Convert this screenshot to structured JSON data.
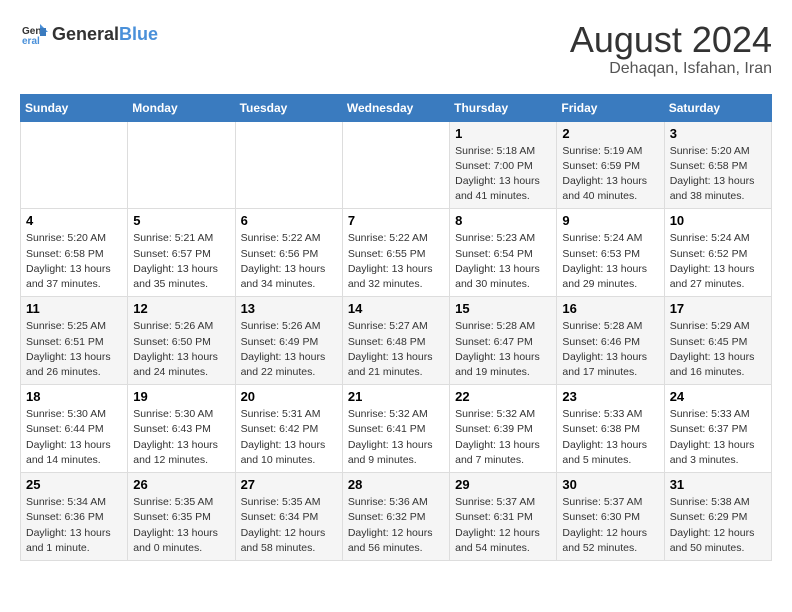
{
  "header": {
    "logo": {
      "general": "General",
      "blue": "Blue"
    },
    "title": "August 2024",
    "subtitle": "Dehaqan, Isfahan, Iran"
  },
  "weekdays": [
    "Sunday",
    "Monday",
    "Tuesday",
    "Wednesday",
    "Thursday",
    "Friday",
    "Saturday"
  ],
  "weeks": [
    [
      {
        "day": "",
        "content": ""
      },
      {
        "day": "",
        "content": ""
      },
      {
        "day": "",
        "content": ""
      },
      {
        "day": "",
        "content": ""
      },
      {
        "day": "1",
        "content": "Sunrise: 5:18 AM\nSunset: 7:00 PM\nDaylight: 13 hours\nand 41 minutes."
      },
      {
        "day": "2",
        "content": "Sunrise: 5:19 AM\nSunset: 6:59 PM\nDaylight: 13 hours\nand 40 minutes."
      },
      {
        "day": "3",
        "content": "Sunrise: 5:20 AM\nSunset: 6:58 PM\nDaylight: 13 hours\nand 38 minutes."
      }
    ],
    [
      {
        "day": "4",
        "content": "Sunrise: 5:20 AM\nSunset: 6:58 PM\nDaylight: 13 hours\nand 37 minutes."
      },
      {
        "day": "5",
        "content": "Sunrise: 5:21 AM\nSunset: 6:57 PM\nDaylight: 13 hours\nand 35 minutes."
      },
      {
        "day": "6",
        "content": "Sunrise: 5:22 AM\nSunset: 6:56 PM\nDaylight: 13 hours\nand 34 minutes."
      },
      {
        "day": "7",
        "content": "Sunrise: 5:22 AM\nSunset: 6:55 PM\nDaylight: 13 hours\nand 32 minutes."
      },
      {
        "day": "8",
        "content": "Sunrise: 5:23 AM\nSunset: 6:54 PM\nDaylight: 13 hours\nand 30 minutes."
      },
      {
        "day": "9",
        "content": "Sunrise: 5:24 AM\nSunset: 6:53 PM\nDaylight: 13 hours\nand 29 minutes."
      },
      {
        "day": "10",
        "content": "Sunrise: 5:24 AM\nSunset: 6:52 PM\nDaylight: 13 hours\nand 27 minutes."
      }
    ],
    [
      {
        "day": "11",
        "content": "Sunrise: 5:25 AM\nSunset: 6:51 PM\nDaylight: 13 hours\nand 26 minutes."
      },
      {
        "day": "12",
        "content": "Sunrise: 5:26 AM\nSunset: 6:50 PM\nDaylight: 13 hours\nand 24 minutes."
      },
      {
        "day": "13",
        "content": "Sunrise: 5:26 AM\nSunset: 6:49 PM\nDaylight: 13 hours\nand 22 minutes."
      },
      {
        "day": "14",
        "content": "Sunrise: 5:27 AM\nSunset: 6:48 PM\nDaylight: 13 hours\nand 21 minutes."
      },
      {
        "day": "15",
        "content": "Sunrise: 5:28 AM\nSunset: 6:47 PM\nDaylight: 13 hours\nand 19 minutes."
      },
      {
        "day": "16",
        "content": "Sunrise: 5:28 AM\nSunset: 6:46 PM\nDaylight: 13 hours\nand 17 minutes."
      },
      {
        "day": "17",
        "content": "Sunrise: 5:29 AM\nSunset: 6:45 PM\nDaylight: 13 hours\nand 16 minutes."
      }
    ],
    [
      {
        "day": "18",
        "content": "Sunrise: 5:30 AM\nSunset: 6:44 PM\nDaylight: 13 hours\nand 14 minutes."
      },
      {
        "day": "19",
        "content": "Sunrise: 5:30 AM\nSunset: 6:43 PM\nDaylight: 13 hours\nand 12 minutes."
      },
      {
        "day": "20",
        "content": "Sunrise: 5:31 AM\nSunset: 6:42 PM\nDaylight: 13 hours\nand 10 minutes."
      },
      {
        "day": "21",
        "content": "Sunrise: 5:32 AM\nSunset: 6:41 PM\nDaylight: 13 hours\nand 9 minutes."
      },
      {
        "day": "22",
        "content": "Sunrise: 5:32 AM\nSunset: 6:39 PM\nDaylight: 13 hours\nand 7 minutes."
      },
      {
        "day": "23",
        "content": "Sunrise: 5:33 AM\nSunset: 6:38 PM\nDaylight: 13 hours\nand 5 minutes."
      },
      {
        "day": "24",
        "content": "Sunrise: 5:33 AM\nSunset: 6:37 PM\nDaylight: 13 hours\nand 3 minutes."
      }
    ],
    [
      {
        "day": "25",
        "content": "Sunrise: 5:34 AM\nSunset: 6:36 PM\nDaylight: 13 hours\nand 1 minute."
      },
      {
        "day": "26",
        "content": "Sunrise: 5:35 AM\nSunset: 6:35 PM\nDaylight: 13 hours\nand 0 minutes."
      },
      {
        "day": "27",
        "content": "Sunrise: 5:35 AM\nSunset: 6:34 PM\nDaylight: 12 hours\nand 58 minutes."
      },
      {
        "day": "28",
        "content": "Sunrise: 5:36 AM\nSunset: 6:32 PM\nDaylight: 12 hours\nand 56 minutes."
      },
      {
        "day": "29",
        "content": "Sunrise: 5:37 AM\nSunset: 6:31 PM\nDaylight: 12 hours\nand 54 minutes."
      },
      {
        "day": "30",
        "content": "Sunrise: 5:37 AM\nSunset: 6:30 PM\nDaylight: 12 hours\nand 52 minutes."
      },
      {
        "day": "31",
        "content": "Sunrise: 5:38 AM\nSunset: 6:29 PM\nDaylight: 12 hours\nand 50 minutes."
      }
    ]
  ]
}
